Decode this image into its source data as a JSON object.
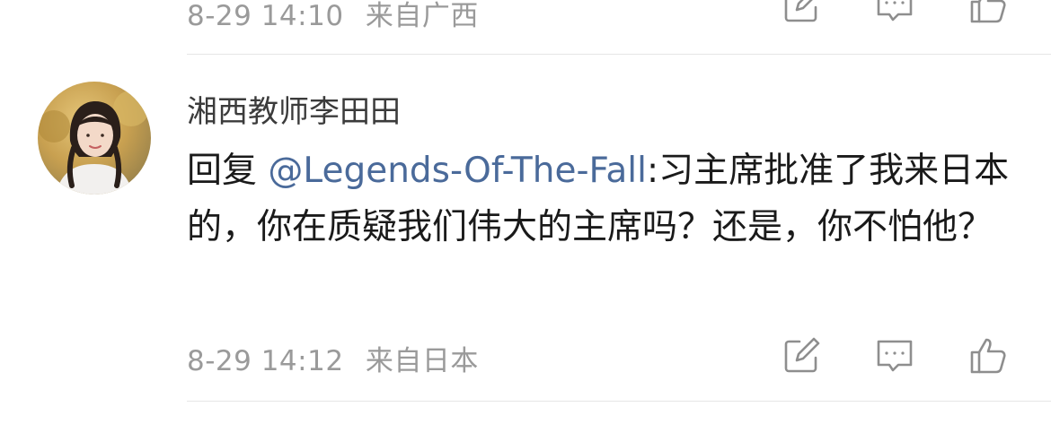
{
  "previous_comment": {
    "timestamp": "8-29 14:10",
    "location": "来自广西"
  },
  "comment": {
    "username": "湘西教师李田田",
    "reply_prefix": "回复 ",
    "mention": "@Legends-Of-The-Fall",
    "body": ":习主席批准了我来日本的，你在质疑我们伟大的主席吗？还是，你不怕他？",
    "timestamp": "8-29 14:12",
    "location": "来自日本"
  },
  "icons": {
    "edit": "edit-icon",
    "comment": "comment-icon",
    "like": "thumbs-up-icon"
  },
  "colors": {
    "mention": "#4a6a9a",
    "meta": "#9a9a9a",
    "icon": "#8e8e8e",
    "divider": "#e6e6e6"
  }
}
